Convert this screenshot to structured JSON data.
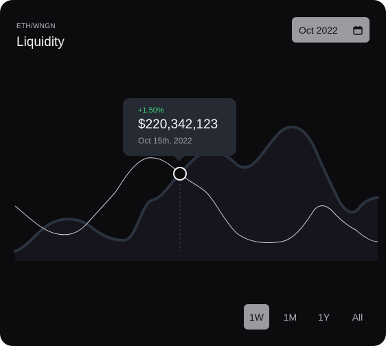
{
  "header": {
    "pair": "ETH/WNGN",
    "title": "Liquidity"
  },
  "date_picker": {
    "value": "Oct 2022",
    "icon": "calendar-icon"
  },
  "tooltip": {
    "change": "+1.50%",
    "value": "$220,342,123",
    "date": "Oct 15th, 2022"
  },
  "range_tabs": [
    {
      "label": "1W",
      "active": true
    },
    {
      "label": "1M",
      "active": false
    },
    {
      "label": "1Y",
      "active": false
    },
    {
      "label": "All",
      "active": false
    }
  ],
  "colors": {
    "background": "#0c0c0f",
    "primary_line": "#2b3240",
    "secondary_line": "#cfcfd6",
    "area_fill": "#16151d",
    "positive": "#3ecb7a"
  }
}
